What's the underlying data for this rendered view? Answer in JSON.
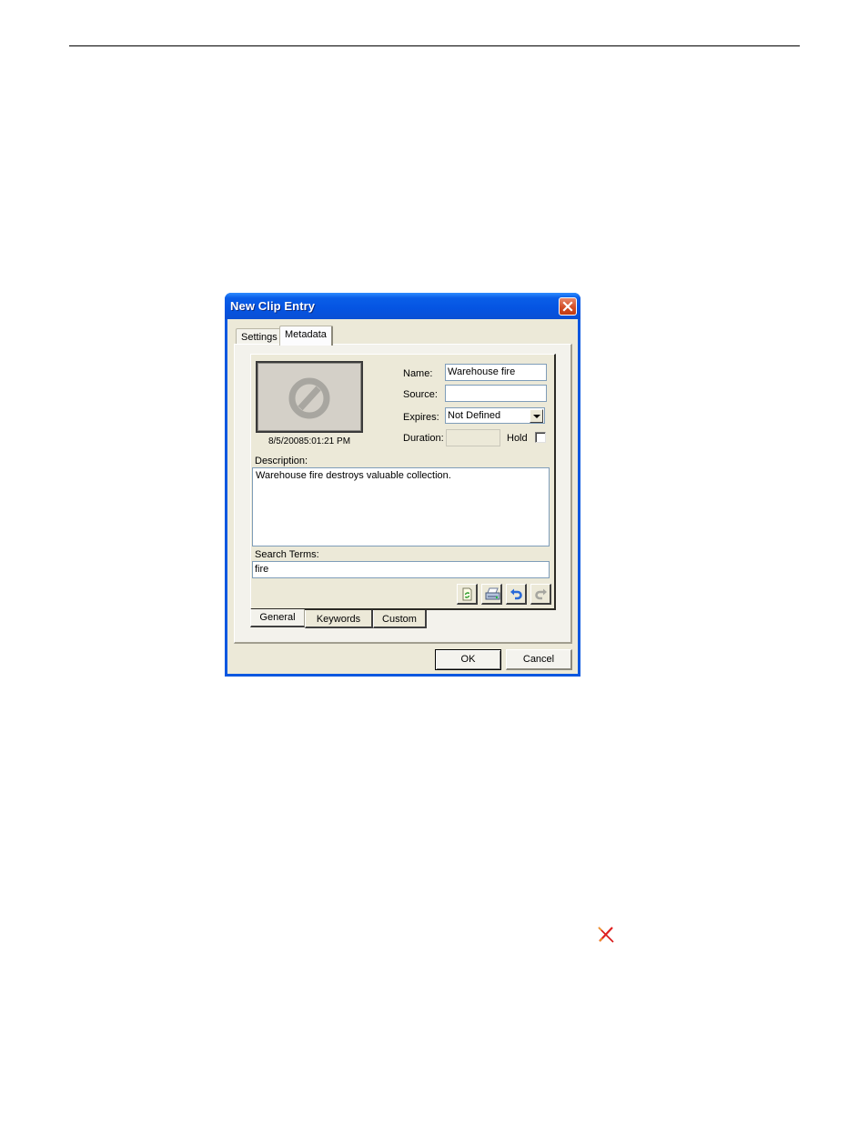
{
  "dialog": {
    "title": "New Clip Entry",
    "close_icon": "close-icon",
    "outer_tabs": [
      {
        "label": "Settings",
        "active": false
      },
      {
        "label": "Metadata",
        "active": true
      }
    ],
    "preview": {
      "icon": "no-preview-icon",
      "timestamp": "8/5/20085:01:21 PM"
    },
    "fields": {
      "name": {
        "label": "Name:",
        "value": "Warehouse fire"
      },
      "source": {
        "label": "Source:",
        "value": ""
      },
      "expires": {
        "label": "Expires:",
        "value": "Not Defined"
      },
      "duration": {
        "label": "Duration:",
        "value": ""
      },
      "hold": {
        "label": "Hold",
        "checked": false
      }
    },
    "description": {
      "label": "Description:",
      "value": "Warehouse fire destroys valuable collection."
    },
    "search_terms": {
      "label": "Search Terms:",
      "value": "fire"
    },
    "toolbar": [
      {
        "icon": "refresh-document-icon",
        "enabled": true
      },
      {
        "icon": "print-icon",
        "enabled": true
      },
      {
        "icon": "undo-icon",
        "enabled": true
      },
      {
        "icon": "redo-icon",
        "enabled": false
      }
    ],
    "bottom_tabs": [
      {
        "label": "General",
        "active": true
      },
      {
        "label": "Keywords",
        "active": false
      },
      {
        "label": "Custom",
        "active": false
      }
    ],
    "buttons": {
      "ok": "OK",
      "cancel": "Cancel"
    }
  },
  "page": {
    "annotation_icon": "red-x-icon"
  }
}
